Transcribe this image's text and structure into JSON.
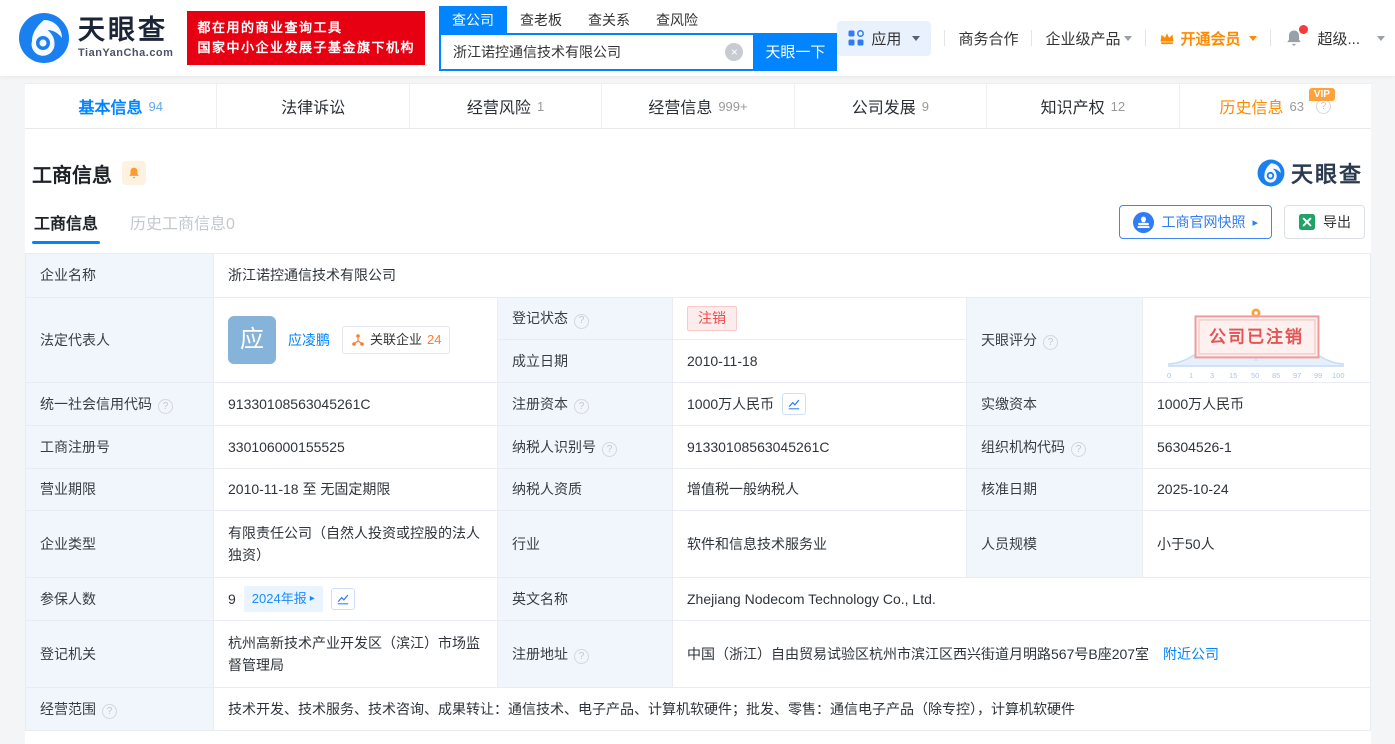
{
  "icons": {
    "close": "×",
    "arrow_right": "▸",
    "question": "?"
  },
  "colors": {
    "accent": "#0084ff",
    "brand_red": "#e60012",
    "orange": "#ff8a00",
    "danger": "#f04b4b"
  },
  "header": {
    "brand": {
      "name": "天眼查",
      "domain": "TianYanCha.com"
    },
    "promo": {
      "line1": "都在用的商业查询工具",
      "line2": "国家中小企业发展子基金旗下机构"
    },
    "search": {
      "tabs": [
        "查公司",
        "查老板",
        "查关系",
        "查风险"
      ],
      "value": "浙江诺控通信技术有限公司",
      "button": "天眼一下"
    },
    "menu": {
      "apps": "应用",
      "cooperation": "商务合作",
      "enterprise": "企业级产品",
      "vip": "开通会员",
      "account": "超级..."
    }
  },
  "nav": {
    "tabs": [
      {
        "label": "基本信息",
        "count": "94"
      },
      {
        "label": "法律诉讼",
        "count": ""
      },
      {
        "label": "经营风险",
        "count": "1"
      },
      {
        "label": "经营信息",
        "count": "999+"
      },
      {
        "label": "公司发展",
        "count": "9"
      },
      {
        "label": "知识产权",
        "count": "12"
      },
      {
        "label": "历史信息",
        "count": "63",
        "vip": "VIP"
      }
    ]
  },
  "section": {
    "title": "工商信息",
    "watermark": "天眼查",
    "tabs": {
      "current": "工商信息",
      "history": "历史工商信息0"
    },
    "buttons": {
      "snapshot": "工商官网快照",
      "export": "导出"
    }
  },
  "fields": {
    "company_name": {
      "label": "企业名称",
      "value": "浙江诺控通信技术有限公司"
    },
    "legal_rep": {
      "label": "法定代表人",
      "avatar": "应",
      "name": "应凌鹏",
      "related": "关联企业",
      "related_count": "24"
    },
    "reg_status": {
      "label": "登记状态",
      "value": "注销"
    },
    "establish_date": {
      "label": "成立日期",
      "value": "2010-11-18"
    },
    "score": {
      "label": "天眼评分"
    },
    "credit_code": {
      "label": "统一社会信用代码",
      "value": "91330108563045261C"
    },
    "reg_capital": {
      "label": "注册资本",
      "value": "1000万人民币"
    },
    "paid_capital": {
      "label": "实缴资本",
      "value": "1000万人民币"
    },
    "reg_number": {
      "label": "工商注册号",
      "value": "330106000155525"
    },
    "taxpayer_id": {
      "label": "纳税人识别号",
      "value": "91330108563045261C"
    },
    "org_code": {
      "label": "组织机构代码",
      "value": "56304526-1"
    },
    "business_term": {
      "label": "营业期限",
      "value": "2010-11-18 至 无固定期限"
    },
    "taxpayer_quality": {
      "label": "纳税人资质",
      "value": "增值税一般纳税人"
    },
    "approval_date": {
      "label": "核准日期",
      "value": "2025-10-24"
    },
    "company_type": {
      "label": "企业类型",
      "value": "有限责任公司（自然人投资或控股的法人独资）"
    },
    "industry": {
      "label": "行业",
      "value": "软件和信息技术服务业"
    },
    "staff_size": {
      "label": "人员规模",
      "value": "小于50人"
    },
    "insured": {
      "label": "参保人数",
      "value": "9",
      "report": "2024年报"
    },
    "english_name": {
      "label": "英文名称",
      "value": "Zhejiang Nodecom Technology Co., Ltd."
    },
    "reg_authority": {
      "label": "登记机关",
      "value": "杭州高新技术产业开发区（滨江）市场监督管理局"
    },
    "reg_address": {
      "label": "注册地址",
      "value": "中国（浙江）自由贸易试验区杭州市滨江区西兴街道月明路567号B座207室",
      "nearby": "附近公司"
    },
    "business_scope": {
      "label": "经营范围",
      "value": "技术开发、技术服务、技术咨询、成果转让：通信技术、电子产品、计算机软硬件；批发、零售：通信电子产品（除专控），计算机软硬件"
    }
  },
  "score_chart": {
    "type": "area",
    "ticks": [
      "0",
      "1",
      "3",
      "15",
      "50",
      "85",
      "97",
      "99",
      "100"
    ],
    "stamp": "公司已注销"
  }
}
